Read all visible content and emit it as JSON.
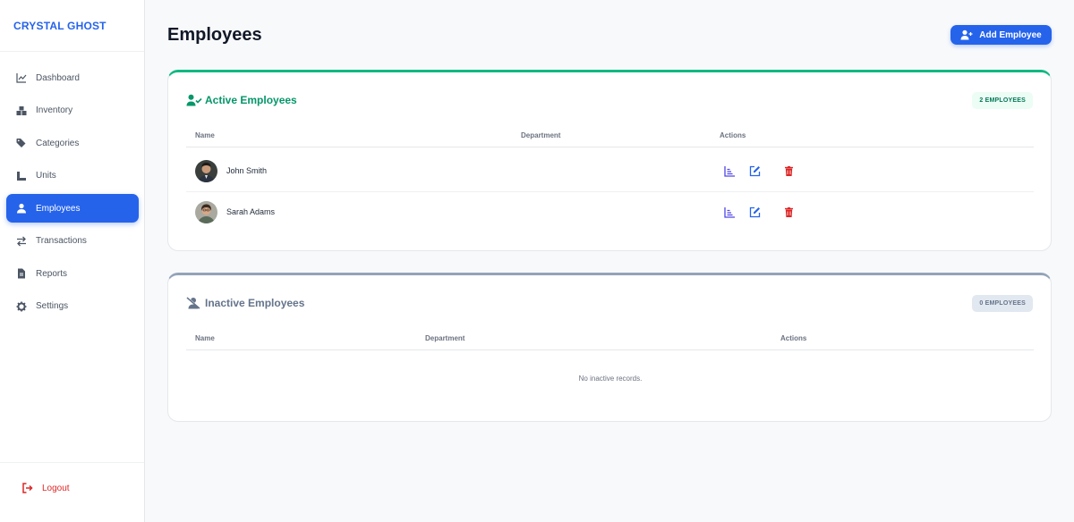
{
  "app": {
    "brand": "CRYSTAL GHOST"
  },
  "sidebar": {
    "items": [
      {
        "label": "Dashboard",
        "icon": "chart-line-icon"
      },
      {
        "label": "Inventory",
        "icon": "boxes-icon"
      },
      {
        "label": "Categories",
        "icon": "tags-icon"
      },
      {
        "label": "Units",
        "icon": "ruler-icon"
      },
      {
        "label": "Employees",
        "icon": "user-icon",
        "active": true
      },
      {
        "label": "Transactions",
        "icon": "exchange-icon"
      },
      {
        "label": "Reports",
        "icon": "file-icon"
      },
      {
        "label": "Settings",
        "icon": "gear-icon"
      }
    ],
    "logout": "Logout"
  },
  "header": {
    "title": "Employees",
    "add_button": "Add Employee"
  },
  "active_section": {
    "title": "Active Employees",
    "badge": "2 EMPLOYEES",
    "columns": [
      "Name",
      "Department",
      "Actions"
    ],
    "rows": [
      {
        "name": "John Smith",
        "department": ""
      },
      {
        "name": "Sarah Adams",
        "department": ""
      }
    ]
  },
  "inactive_section": {
    "title": "Inactive Employees",
    "badge": "0 EMPLOYEES",
    "columns": [
      "Name",
      "Department",
      "Actions"
    ],
    "empty_text": "No inactive records."
  },
  "colors": {
    "primary": "#2563eb",
    "success": "#059669",
    "danger": "#dc2626",
    "muted": "#64748b"
  }
}
